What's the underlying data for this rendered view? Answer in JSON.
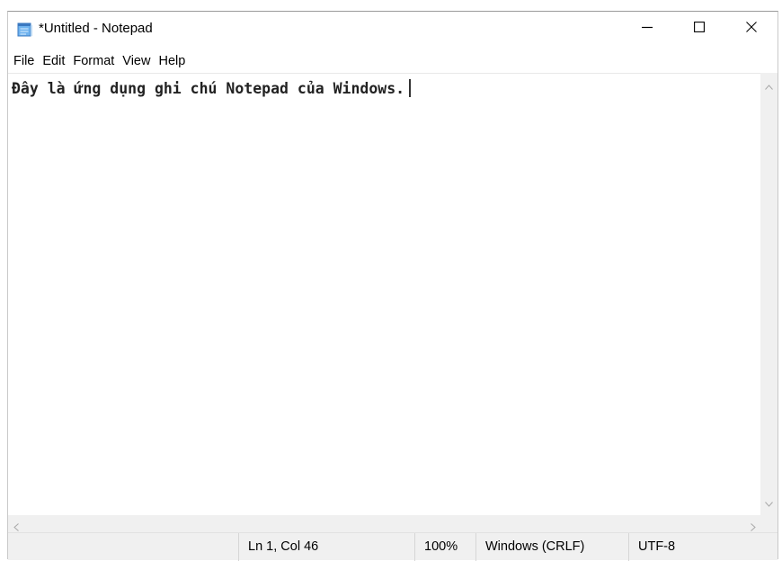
{
  "window": {
    "title": "*Untitled - Notepad"
  },
  "icons": {
    "app": "notepad-icon",
    "minimize": "minimize-icon",
    "maximize": "maximize-icon",
    "close": "close-icon",
    "scroll_up": "chevron-up-icon",
    "scroll_down": "chevron-down-icon",
    "scroll_left": "chevron-left-icon",
    "scroll_right": "chevron-right-icon"
  },
  "menu": {
    "items": [
      {
        "label": "File"
      },
      {
        "label": "Edit"
      },
      {
        "label": "Format"
      },
      {
        "label": "View"
      },
      {
        "label": "Help"
      }
    ]
  },
  "editor": {
    "content": "Đây là ứng dụng ghi chú Notepad của Windows."
  },
  "status": {
    "position": "Ln 1, Col 46",
    "zoom": "100%",
    "line_ending": "Windows (CRLF)",
    "encoding": "UTF-8"
  },
  "colors": {
    "chrome": "#f0f0f0",
    "text": "#000000",
    "icon_blue": "#4a8fd8"
  }
}
